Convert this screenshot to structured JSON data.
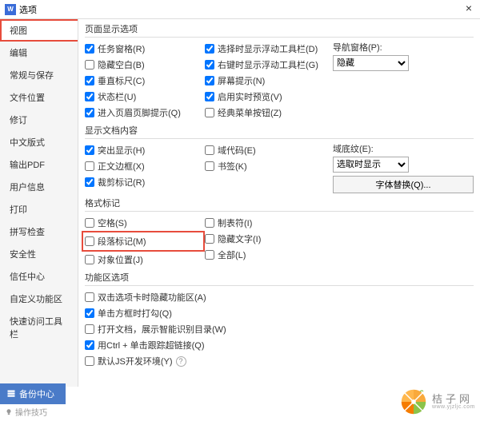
{
  "window": {
    "title": "选项"
  },
  "sidebar": {
    "items": [
      {
        "label": "视图"
      },
      {
        "label": "编辑"
      },
      {
        "label": "常规与保存"
      },
      {
        "label": "文件位置"
      },
      {
        "label": "修订"
      },
      {
        "label": "中文版式"
      },
      {
        "label": "输出PDF"
      },
      {
        "label": "用户信息"
      },
      {
        "label": "打印"
      },
      {
        "label": "拼写检查"
      },
      {
        "label": "安全性"
      },
      {
        "label": "信任中心"
      },
      {
        "label": "自定义功能区"
      },
      {
        "label": "快速访问工具栏"
      }
    ]
  },
  "sections": {
    "page_display": "页面显示选项",
    "show_doc": "显示文档内容",
    "format_marks": "格式标记",
    "func_opts": "功能区选项"
  },
  "page_display": {
    "col1": [
      {
        "label": "任务窗格(R)",
        "checked": true
      },
      {
        "label": "隐藏空白(B)",
        "checked": false
      },
      {
        "label": "垂直标尺(C)",
        "checked": true
      },
      {
        "label": "状态栏(U)",
        "checked": true
      },
      {
        "label": "进入页眉页脚提示(Q)",
        "checked": true
      }
    ],
    "col2": [
      {
        "label": "选择时显示浮动工具栏(D)",
        "checked": true
      },
      {
        "label": "右键时显示浮动工具栏(G)",
        "checked": true
      },
      {
        "label": "屏幕提示(N)",
        "checked": true
      },
      {
        "label": "启用实时预览(V)",
        "checked": true
      },
      {
        "label": "经典菜单按钮(Z)",
        "checked": false
      }
    ],
    "nav_label": "导航窗格(P):",
    "nav_value": "隐藏"
  },
  "show_doc": {
    "col1": [
      {
        "label": "突出显示(H)",
        "checked": true
      },
      {
        "label": "正文边框(X)",
        "checked": false
      },
      {
        "label": "裁剪标记(R)",
        "checked": true
      }
    ],
    "col2": [
      {
        "label": "域代码(E)",
        "checked": false
      },
      {
        "label": "书签(K)",
        "checked": false
      }
    ],
    "domain_label": "域底纹(E):",
    "domain_value": "选取时显示",
    "font_btn": "字体替换(Q)..."
  },
  "format_marks": {
    "col1": [
      {
        "label": "空格(S)",
        "checked": false
      },
      {
        "label": "段落标记(M)",
        "checked": false
      },
      {
        "label": "对象位置(J)",
        "checked": false
      }
    ],
    "col2": [
      {
        "label": "制表符(I)",
        "checked": false
      },
      {
        "label": "隐藏文字(I)",
        "checked": false
      },
      {
        "label": "全部(L)",
        "checked": false
      }
    ]
  },
  "func_opts": {
    "items": [
      {
        "label": "双击选项卡时隐藏功能区(A)",
        "checked": false
      },
      {
        "label": "单击方框时打勾(Q)",
        "checked": true
      },
      {
        "label": "打开文档，展示智能识别目录(W)",
        "checked": false
      },
      {
        "label": "用Ctrl + 单击跟踪超链接(Q)",
        "checked": true
      },
      {
        "label": "默认JS开发环境(Y)",
        "checked": false,
        "help": true
      }
    ]
  },
  "footer": {
    "backup": "备份中心",
    "tips": "操作技巧",
    "logo_cn": "桔子网",
    "logo_en": "www.yjzljc.com"
  }
}
